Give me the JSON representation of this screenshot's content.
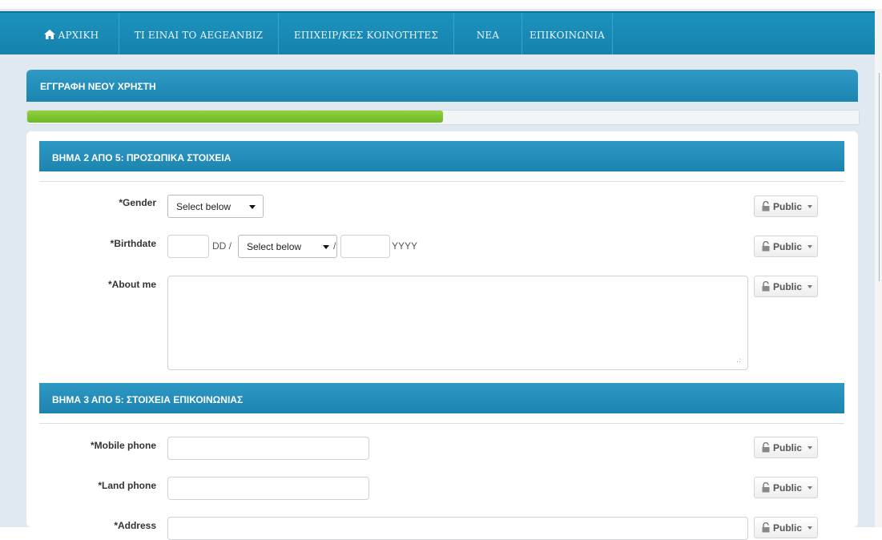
{
  "nav": {
    "home": "ΑΡΧΙΚΗ",
    "about": "ΤΙ ΕΙΝΑΙ ΤΟ AEGEANBIZ",
    "communities": "ΕΠΙΧΕΙΡ/ΚΕΣ ΚΟΙΝΟΤΗΤΕΣ",
    "news": "ΝΕΑ",
    "contact": "ΕΠΙΚΟΙΝΩΝΙΑ"
  },
  "page_title": "ΕΓΓΡΑΦΗ ΝΕΟΥ ΧΡΗΣΤΗ",
  "progress": {
    "fraction": 0.5
  },
  "step2": {
    "title": "ΒΗΜΑ 2 ΑΠΟ 5: ΠΡΟΣΩΠΙΚΑ ΣΤΟΙΧΕΙΑ",
    "gender_label": "*Gender",
    "gender_value": "Select below",
    "birthdate_label": "*Birthdate",
    "day_hint": "DD /",
    "month_value": "Select below",
    "slash": "/",
    "year_hint": "YYYY",
    "about_label": "*About me"
  },
  "step3": {
    "title": "ΒΗΜΑ 3 ΑΠΟ 5: ΣΤΟΙΧΕΙΑ ΕΠΙΚΟΙΝΩΝΙΑΣ",
    "mobile_label": "*Mobile phone",
    "land_label": "*Land phone",
    "address_label": "*Address"
  },
  "privacy_label": "Public",
  "icons": {
    "home": "home-icon",
    "lock": "lock-icon",
    "caret": "caret-down-icon"
  },
  "colors": {
    "nav_bg": "#1a8cb8",
    "header_bg": "#2590bd",
    "progress": "#7cc42f"
  }
}
